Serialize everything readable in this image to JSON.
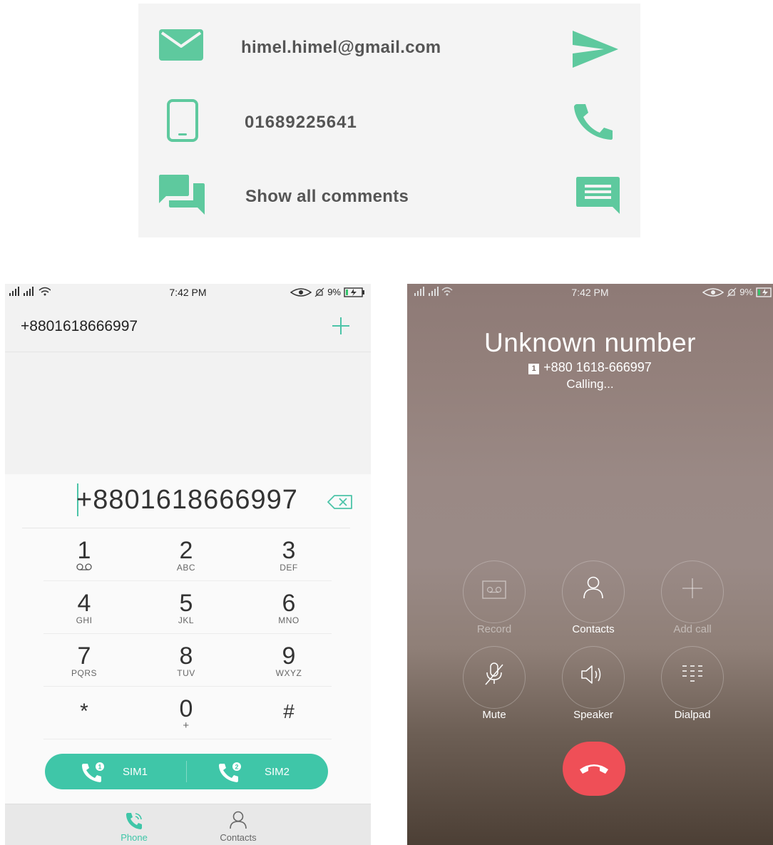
{
  "contact_card": {
    "email": "himel.himel@gmail.com",
    "phone": "01689225641",
    "comments_label": "Show all comments",
    "icons": {
      "email": "mail-icon",
      "send": "send-icon",
      "phone": "mobile-phone-icon",
      "call": "call-icon",
      "comments": "chat-bubbles-icon",
      "message": "message-icon"
    },
    "accent_color": "#5ec99e"
  },
  "dialer": {
    "status_bar": {
      "time": "7:42 PM",
      "battery": "9%"
    },
    "header_number": "+8801618666997",
    "input_value": "+8801618666997",
    "keys": [
      {
        "digit": "1",
        "letters": "QO"
      },
      {
        "digit": "2",
        "letters": "ABC"
      },
      {
        "digit": "3",
        "letters": "DEF"
      },
      {
        "digit": "4",
        "letters": "GHI"
      },
      {
        "digit": "5",
        "letters": "JKL"
      },
      {
        "digit": "6",
        "letters": "MNO"
      },
      {
        "digit": "7",
        "letters": "PQRS"
      },
      {
        "digit": "8",
        "letters": "TUV"
      },
      {
        "digit": "9",
        "letters": "WXYZ"
      },
      {
        "digit": "*",
        "letters": ""
      },
      {
        "digit": "0",
        "letters": "+"
      },
      {
        "digit": "#",
        "letters": ""
      }
    ],
    "sim_buttons": [
      {
        "label": "SIM1",
        "badge": "1"
      },
      {
        "label": "SIM2",
        "badge": "2"
      }
    ],
    "nav": [
      {
        "label": "Phone",
        "active": true
      },
      {
        "label": "Contacts",
        "active": false
      }
    ],
    "accent_color": "#3fc6a8"
  },
  "calling": {
    "status_bar": {
      "time": "7:42 PM",
      "battery": "9%"
    },
    "caller_name": "Unknown number",
    "sim_badge": "1",
    "caller_number": "+880 1618-666997",
    "status": "Calling...",
    "controls": [
      {
        "label": "Record",
        "icon": "record-icon",
        "enabled": false
      },
      {
        "label": "Contacts",
        "icon": "contact-icon",
        "enabled": true
      },
      {
        "label": "Add call",
        "icon": "add-icon",
        "enabled": false
      },
      {
        "label": "Mute",
        "icon": "mute-icon",
        "enabled": true
      },
      {
        "label": "Speaker",
        "icon": "speaker-icon",
        "enabled": true
      },
      {
        "label": "Dialpad",
        "icon": "dialpad-icon",
        "enabled": true
      }
    ],
    "hangup_color": "#ef4f57"
  }
}
